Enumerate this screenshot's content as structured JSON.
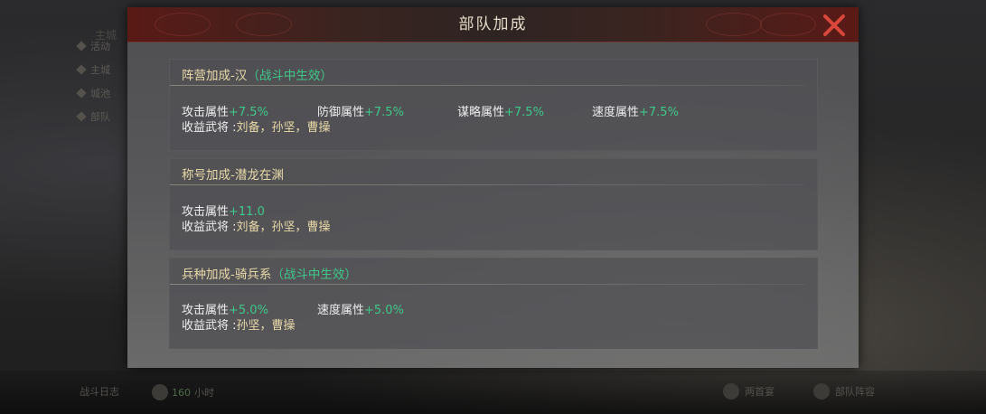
{
  "background": {
    "sidebar_items": [
      "活动",
      "主城",
      "城池",
      "部队"
    ],
    "top_text": "主城",
    "bottom_left": "战斗日志",
    "bottom_mid_num": "160",
    "bottom_mid_unit": "小时",
    "bottom_right1": "两首宴",
    "bottom_right2": "部队阵容"
  },
  "dialog": {
    "title": "部队加成",
    "close_icon": "close-x-icon",
    "sections": [
      {
        "name": "阵营加成-汉",
        "effect_note": "（战斗中生效）",
        "attrs": [
          {
            "label": "攻击属性",
            "value": "+7.5%"
          },
          {
            "label": "防御属性",
            "value": "+7.5%"
          },
          {
            "label": "谋略属性",
            "value": "+7.5%"
          },
          {
            "label": "速度属性",
            "value": "+7.5%"
          }
        ],
        "heroes_label": "收益武将 :",
        "heroes": "刘备，孙坚，曹操"
      },
      {
        "name": "称号加成-潜龙在渊",
        "effect_note": "",
        "attrs": [
          {
            "label": "攻击属性",
            "value": "+11.0"
          }
        ],
        "heroes_label": "收益武将 :",
        "heroes": "刘备，孙坚，曹操"
      },
      {
        "name": "兵种加成-骑兵系",
        "effect_note": "（战斗中生效）",
        "attrs": [
          {
            "label": "攻击属性",
            "value": "+5.0%"
          },
          {
            "label": "速度属性",
            "value": "+5.0%"
          }
        ],
        "heroes_label": "收益武将 :",
        "heroes": "孙坚，曹操"
      }
    ]
  },
  "colors": {
    "accent_green": "#3fc78a",
    "header_gold": "#e9d9a8",
    "close_red": "#d9473c"
  }
}
